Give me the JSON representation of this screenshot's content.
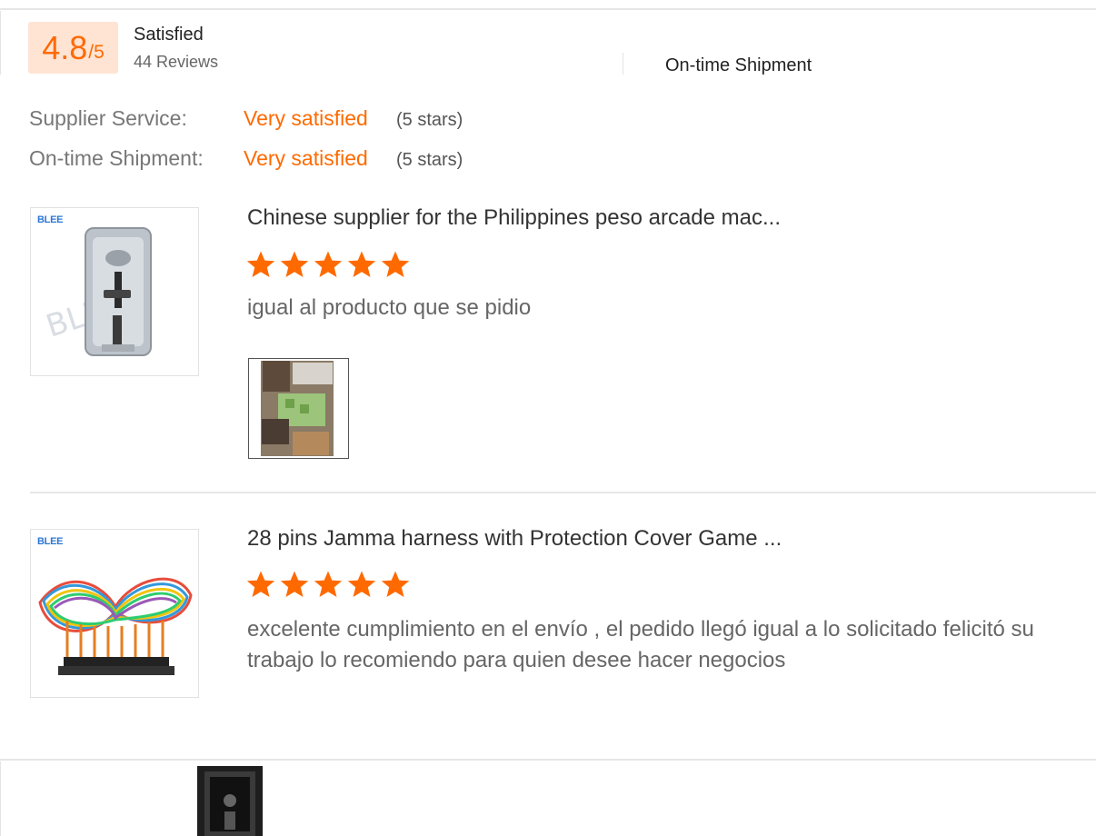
{
  "summary": {
    "score": "4.8",
    "score_suffix": "/5",
    "label": "Satisfied",
    "reviews": "44 Reviews",
    "ontime_heading": "On-time Shipment"
  },
  "ratings": [
    {
      "key": "Supplier Service:",
      "value": "Very satisfied",
      "stars": "(5 stars)"
    },
    {
      "key": "On-time Shipment:",
      "value": "Very satisfied",
      "stars": "(5 stars)"
    }
  ],
  "reviews": [
    {
      "brand": "BLEE",
      "title": "Chinese supplier for the Philippines peso arcade mac...",
      "rating": 5,
      "text": "igual al producto que se pidio"
    },
    {
      "brand": "BLEE",
      "title": "28 pins Jamma harness with Protection Cover Game ...",
      "rating": 5,
      "text": "excelente cumplimiento en el envío , el pedido llegó igual a lo solicitado felicitó su trabajo   lo recomiendo para quien desee hacer negocios"
    }
  ],
  "colors": {
    "accent": "#ff6a00",
    "score_bg": "#ffe4d4"
  }
}
